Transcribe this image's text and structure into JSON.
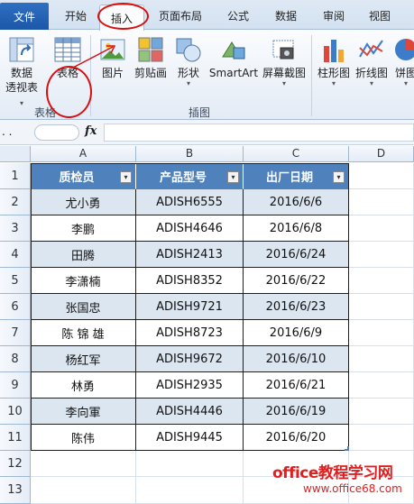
{
  "ribbon_tabs": {
    "file": "文件",
    "home": "开始",
    "insert": "插入",
    "page_layout": "页面布局",
    "formulas": "公式",
    "data": "数据",
    "review": "审阅",
    "view": "视图"
  },
  "ribbon": {
    "pivot_line1": "数据",
    "pivot_line2": "透视表",
    "pivot_arrow": "▾",
    "table": "表格",
    "picture": "图片",
    "clip_art": "剪贴画",
    "shapes": "形状",
    "shapes_arrow": "▾",
    "smartart": "SmartArt",
    "screenshot": "屏幕截图",
    "screenshot_arrow": "▾",
    "column_chart": "柱形图",
    "column_arrow": "▾",
    "line_chart": "折线图",
    "line_arrow": "▾",
    "pie_chart": "饼图",
    "pie_arrow": "▾",
    "group_tables": "表格",
    "group_illustrations": "插图"
  },
  "formula_bar": {
    "name_box": ". .",
    "fx_label": "fx",
    "value": ""
  },
  "columns": [
    "A",
    "B",
    "C",
    "D"
  ],
  "rows": [
    "1",
    "2",
    "3",
    "4",
    "5",
    "6",
    "7",
    "8",
    "9",
    "10",
    "11",
    "12",
    "13"
  ],
  "table": {
    "headers": [
      "质检员",
      "产品型号",
      "出厂日期"
    ],
    "filter_glyph": "▾",
    "data": [
      [
        "尤小勇",
        "ADISH6555",
        "2016/6/6"
      ],
      [
        "李鹏",
        "ADISH4646",
        "2016/6/8"
      ],
      [
        "田腾",
        "ADISH2413",
        "2016/6/24"
      ],
      [
        "李潇楠",
        "ADISH8352",
        "2016/6/22"
      ],
      [
        "张国忠",
        "ADISH9721",
        "2016/6/23"
      ],
      [
        "陈 锦 雄",
        "ADISH8723",
        "2016/6/9"
      ],
      [
        "杨红军",
        "ADISH9672",
        "2016/6/10"
      ],
      [
        "林勇",
        "ADISH2935",
        "2016/6/21"
      ],
      [
        "李向軍",
        "ADISH4446",
        "2016/6/19"
      ],
      [
        "陈伟",
        "ADISH9445",
        "2016/6/20"
      ]
    ]
  },
  "watermark": {
    "line1": "office教程学习网",
    "line2": "www.office68.com"
  },
  "colors": {
    "header_fill": "#4f81bd",
    "band_fill": "#dce6f1",
    "annotation_red": "#d80f0f"
  }
}
